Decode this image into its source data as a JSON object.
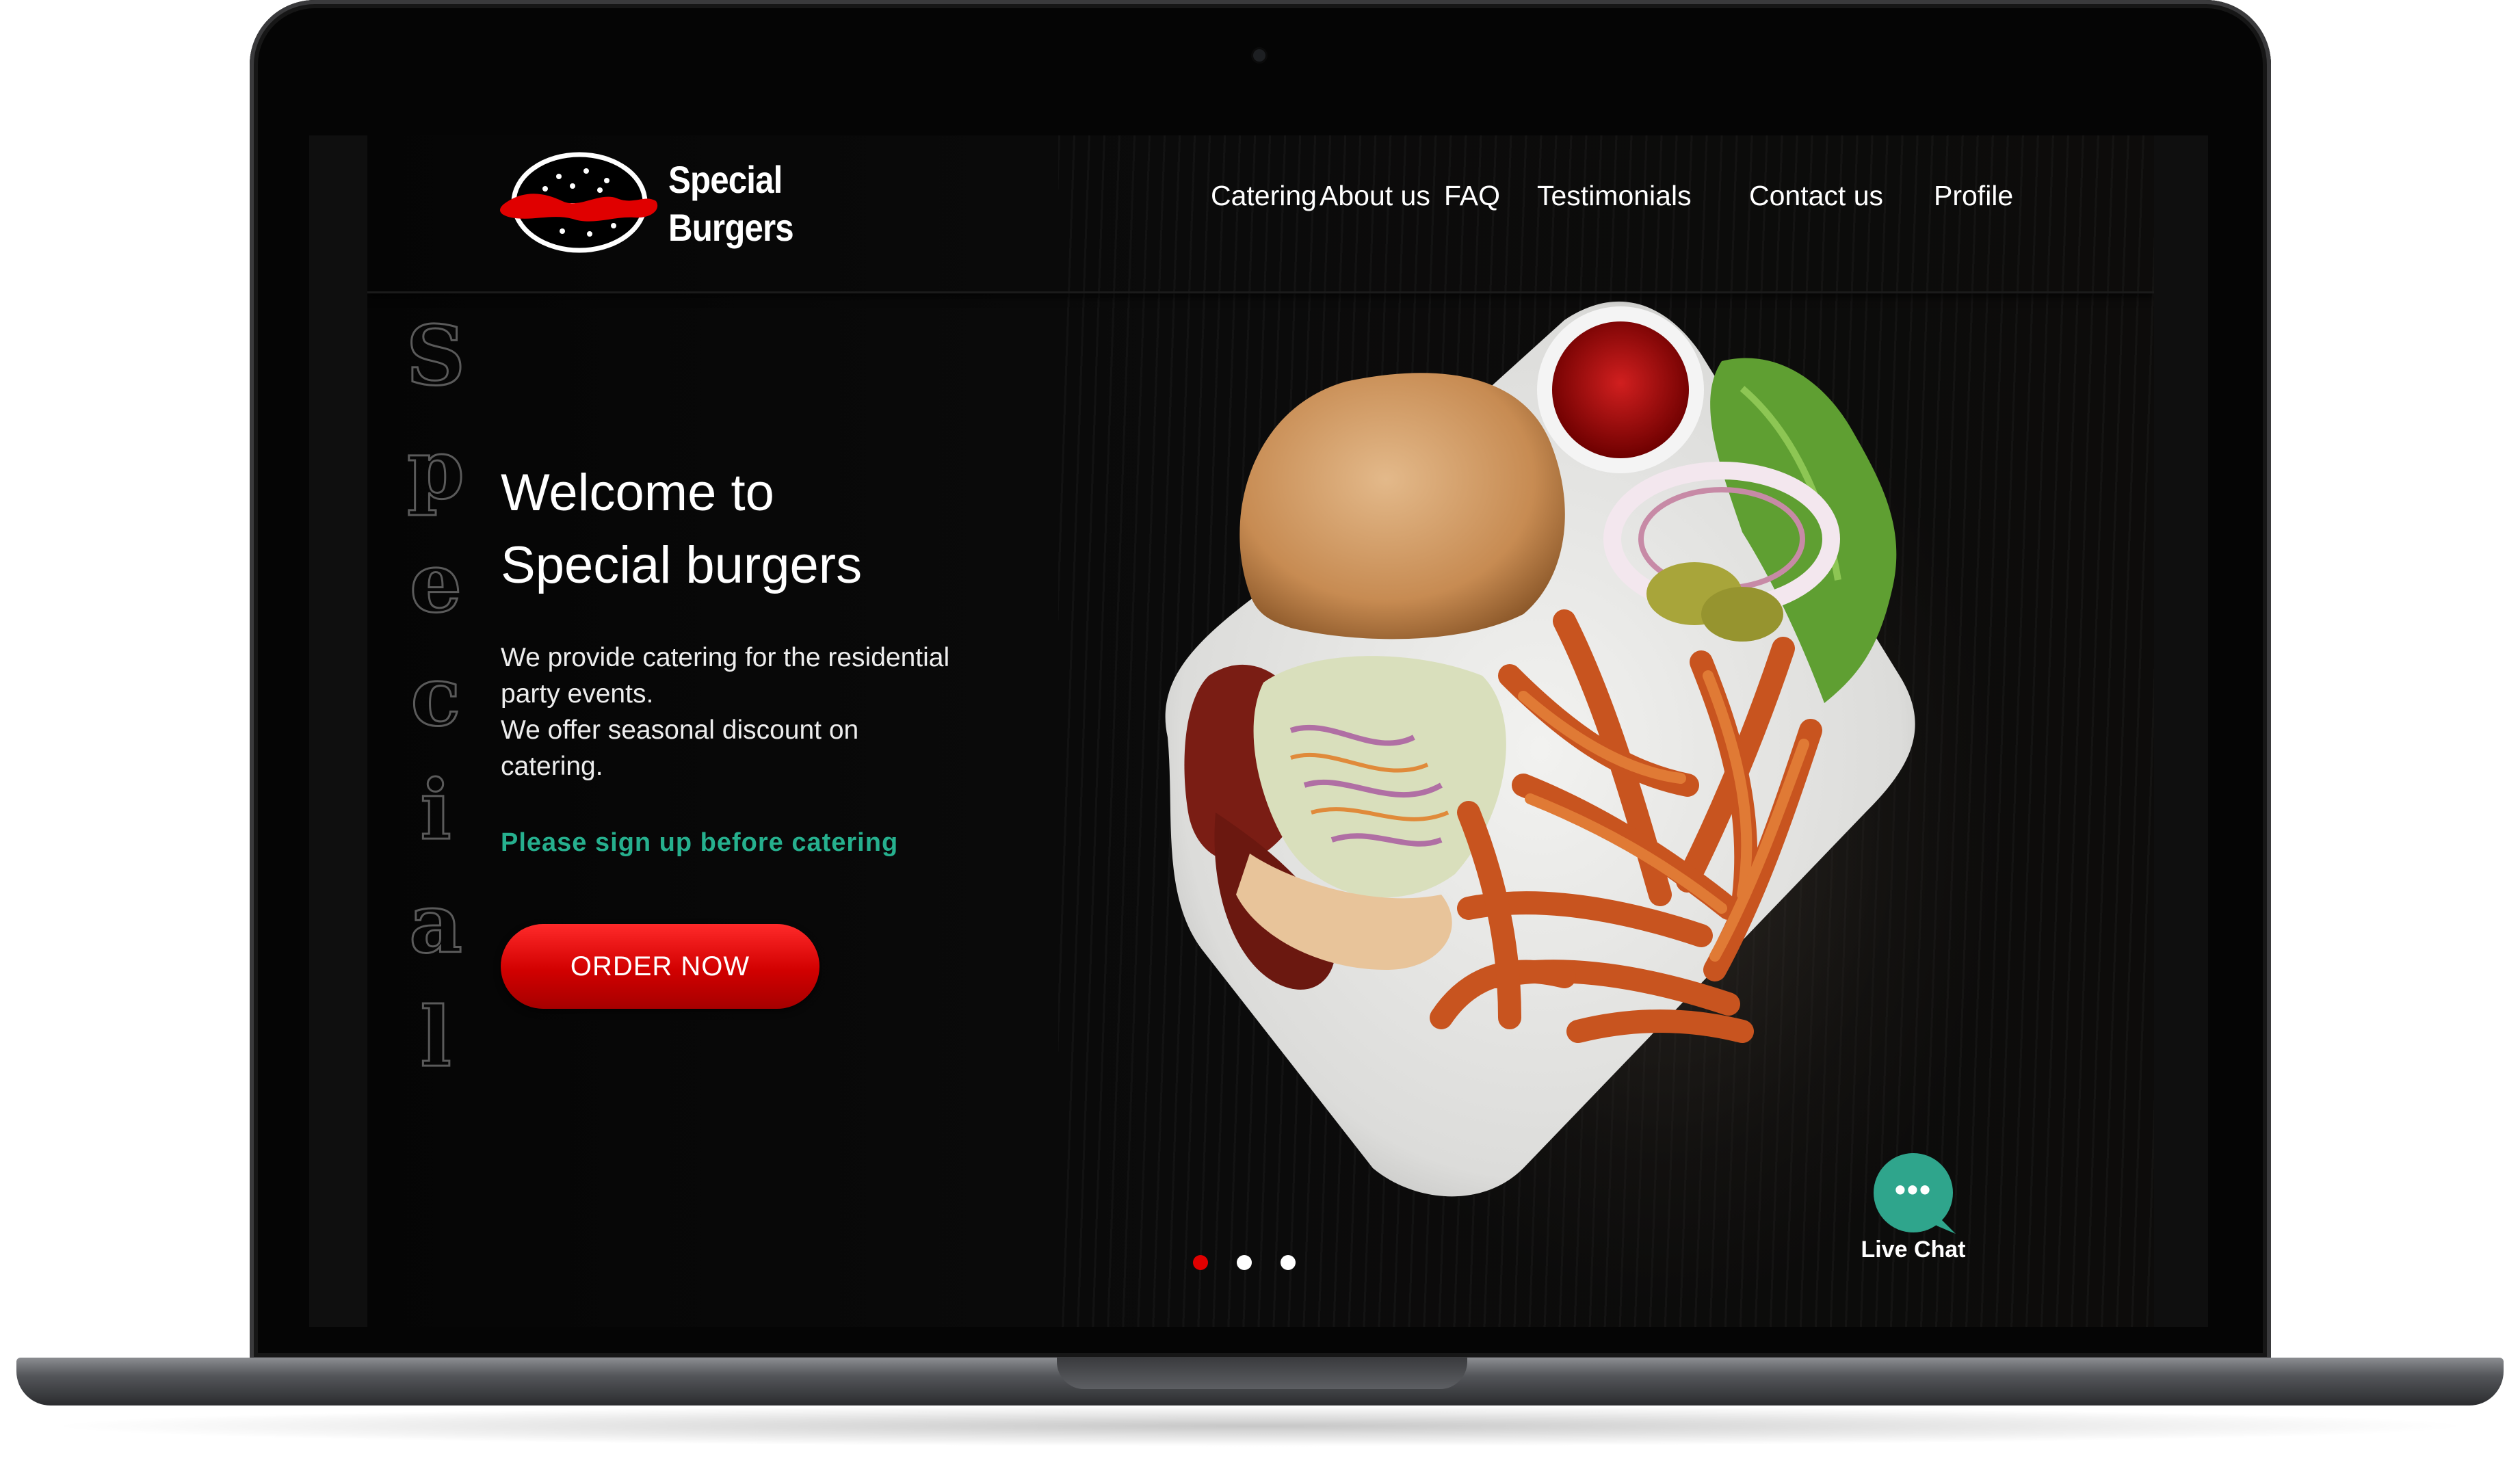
{
  "brand": {
    "line1": "Special",
    "line2": "Burgers"
  },
  "nav": {
    "items": [
      "Catering",
      "About us",
      "FAQ",
      "Testimonials",
      "Contact us",
      "Profile"
    ]
  },
  "side_word": [
    "S",
    "p",
    "e",
    "c",
    "i",
    "a",
    "l"
  ],
  "hero": {
    "title_line1": "Welcome to",
    "title_line2": "Special burgers",
    "desc_line1": "We provide catering for the residential",
    "desc_line2": "party events.",
    "desc_line3": "We offer seasonal discount on",
    "desc_line4": "catering.",
    "signup_text": "Please sign up before catering",
    "order_button": "ORDER NOW"
  },
  "carousel": {
    "active_index": 0,
    "count": 3
  },
  "live_chat": {
    "label": "Live Chat",
    "icon_text": "•••"
  },
  "colors": {
    "accent_red": "#e00000",
    "accent_green": "#26b08e",
    "chat_green": "#2fa58c",
    "background": "#070707"
  }
}
